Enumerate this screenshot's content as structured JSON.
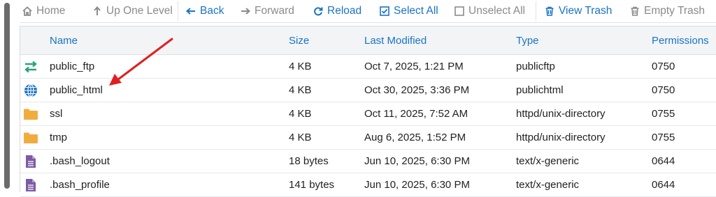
{
  "toolbar": {
    "home": "Home",
    "up": "Up One Level",
    "back": "Back",
    "forward": "Forward",
    "reload": "Reload",
    "select_all": "Select All",
    "unselect_all": "Unselect All",
    "view_trash": "View Trash",
    "empty_trash": "Empty Trash"
  },
  "columns": {
    "name": "Name",
    "size": "Size",
    "modified": "Last Modified",
    "type": "Type",
    "permissions": "Permissions"
  },
  "files": [
    {
      "name": "public_ftp",
      "size": "4 KB",
      "modified": "Oct 7, 2025, 1:21 PM",
      "type": "publicftp",
      "perm": "0750",
      "icon": "transfer-arrows-icon"
    },
    {
      "name": "public_html",
      "size": "4 KB",
      "modified": "Oct 30, 2025, 3:36 PM",
      "type": "publichtml",
      "perm": "0750",
      "icon": "globe-icon"
    },
    {
      "name": "ssl",
      "size": "4 KB",
      "modified": "Oct 11, 2025, 7:52 AM",
      "type": "httpd/unix-directory",
      "perm": "0755",
      "icon": "folder-icon"
    },
    {
      "name": "tmp",
      "size": "4 KB",
      "modified": "Aug 6, 2025, 1:52 PM",
      "type": "httpd/unix-directory",
      "perm": "0755",
      "icon": "folder-icon"
    },
    {
      "name": ".bash_logout",
      "size": "18 bytes",
      "modified": "Jun 10, 2025, 6:30 PM",
      "type": "text/x-generic",
      "perm": "0644",
      "icon": "text-file-icon"
    },
    {
      "name": ".bash_profile",
      "size": "141 bytes",
      "modified": "Jun 10, 2025, 6:30 PM",
      "type": "text/x-generic",
      "perm": "0644",
      "icon": "text-file-icon"
    }
  ],
  "colors": {
    "link_blue": "#1a73c7",
    "folder": "#f0ad3e",
    "globe": "#1a73c7",
    "transfer": "#2aa37a",
    "file": "#7d5aa6",
    "annotation_arrow": "#e02020"
  }
}
